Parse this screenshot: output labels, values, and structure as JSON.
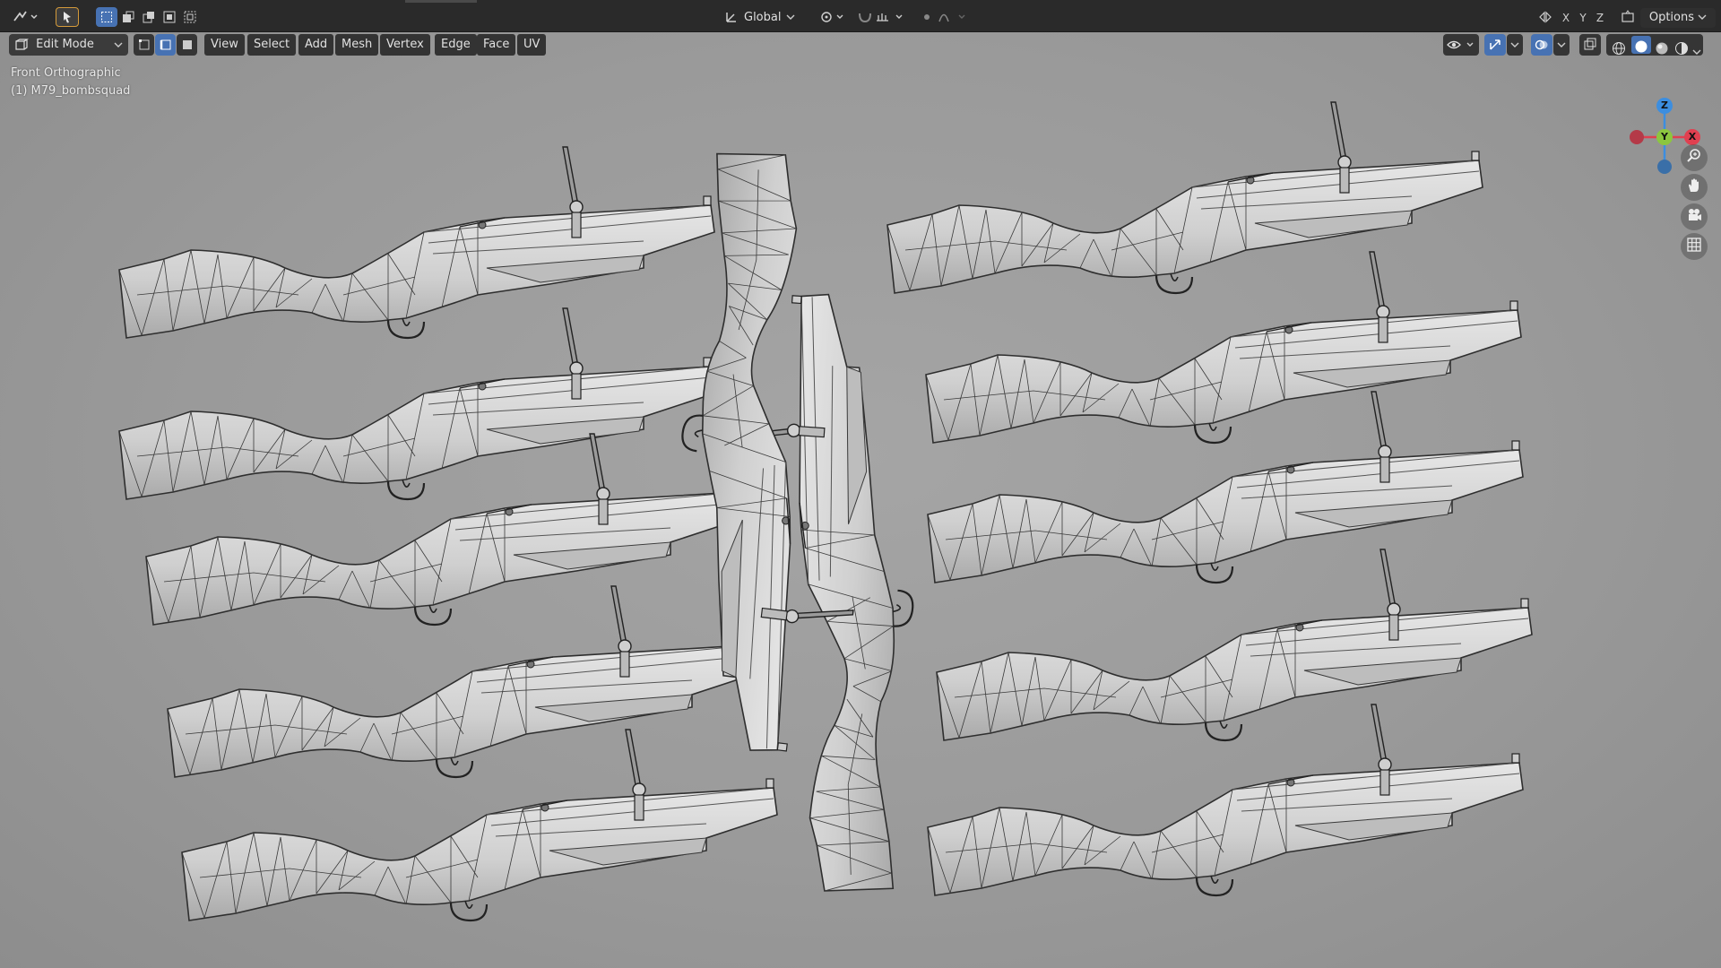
{
  "topbar": {
    "orientation_label": "Global",
    "axis_x": "X",
    "axis_y": "Y",
    "axis_z": "Z",
    "options_label": "Options"
  },
  "viewport_header": {
    "mode_label": "Edit Mode",
    "menus": [
      "View",
      "Select",
      "Add",
      "Mesh",
      "Vertex",
      "Edge",
      "Face",
      "UV"
    ]
  },
  "viewport": {
    "view_name": "Front Orthographic",
    "object_name": "(1) M79_bombsquad"
  },
  "gizmo": {
    "z_label": "Z",
    "y_label": "Y",
    "x_label": "X",
    "colors": {
      "x": "#e04050",
      "y": "#8cc63f",
      "z": "#3c8ee0"
    }
  },
  "icons": [
    "editor-type-icon",
    "select-tool-icon",
    "box-select-icons",
    "transform-orientation-icon",
    "pivot-icon",
    "snap-icon",
    "proportional-edit-icon",
    "vertex-select-icon",
    "edge-select-icon",
    "face-select-icon",
    "visibility-icon",
    "gizmo-toggle-icon",
    "overlay-icon",
    "xray-icon",
    "wireframe-shading-icon",
    "solid-shading-icon",
    "material-shading-icon",
    "rendered-shading-icon",
    "zoom-icon",
    "hand-pan-icon",
    "camera-icon",
    "grid-icon"
  ]
}
